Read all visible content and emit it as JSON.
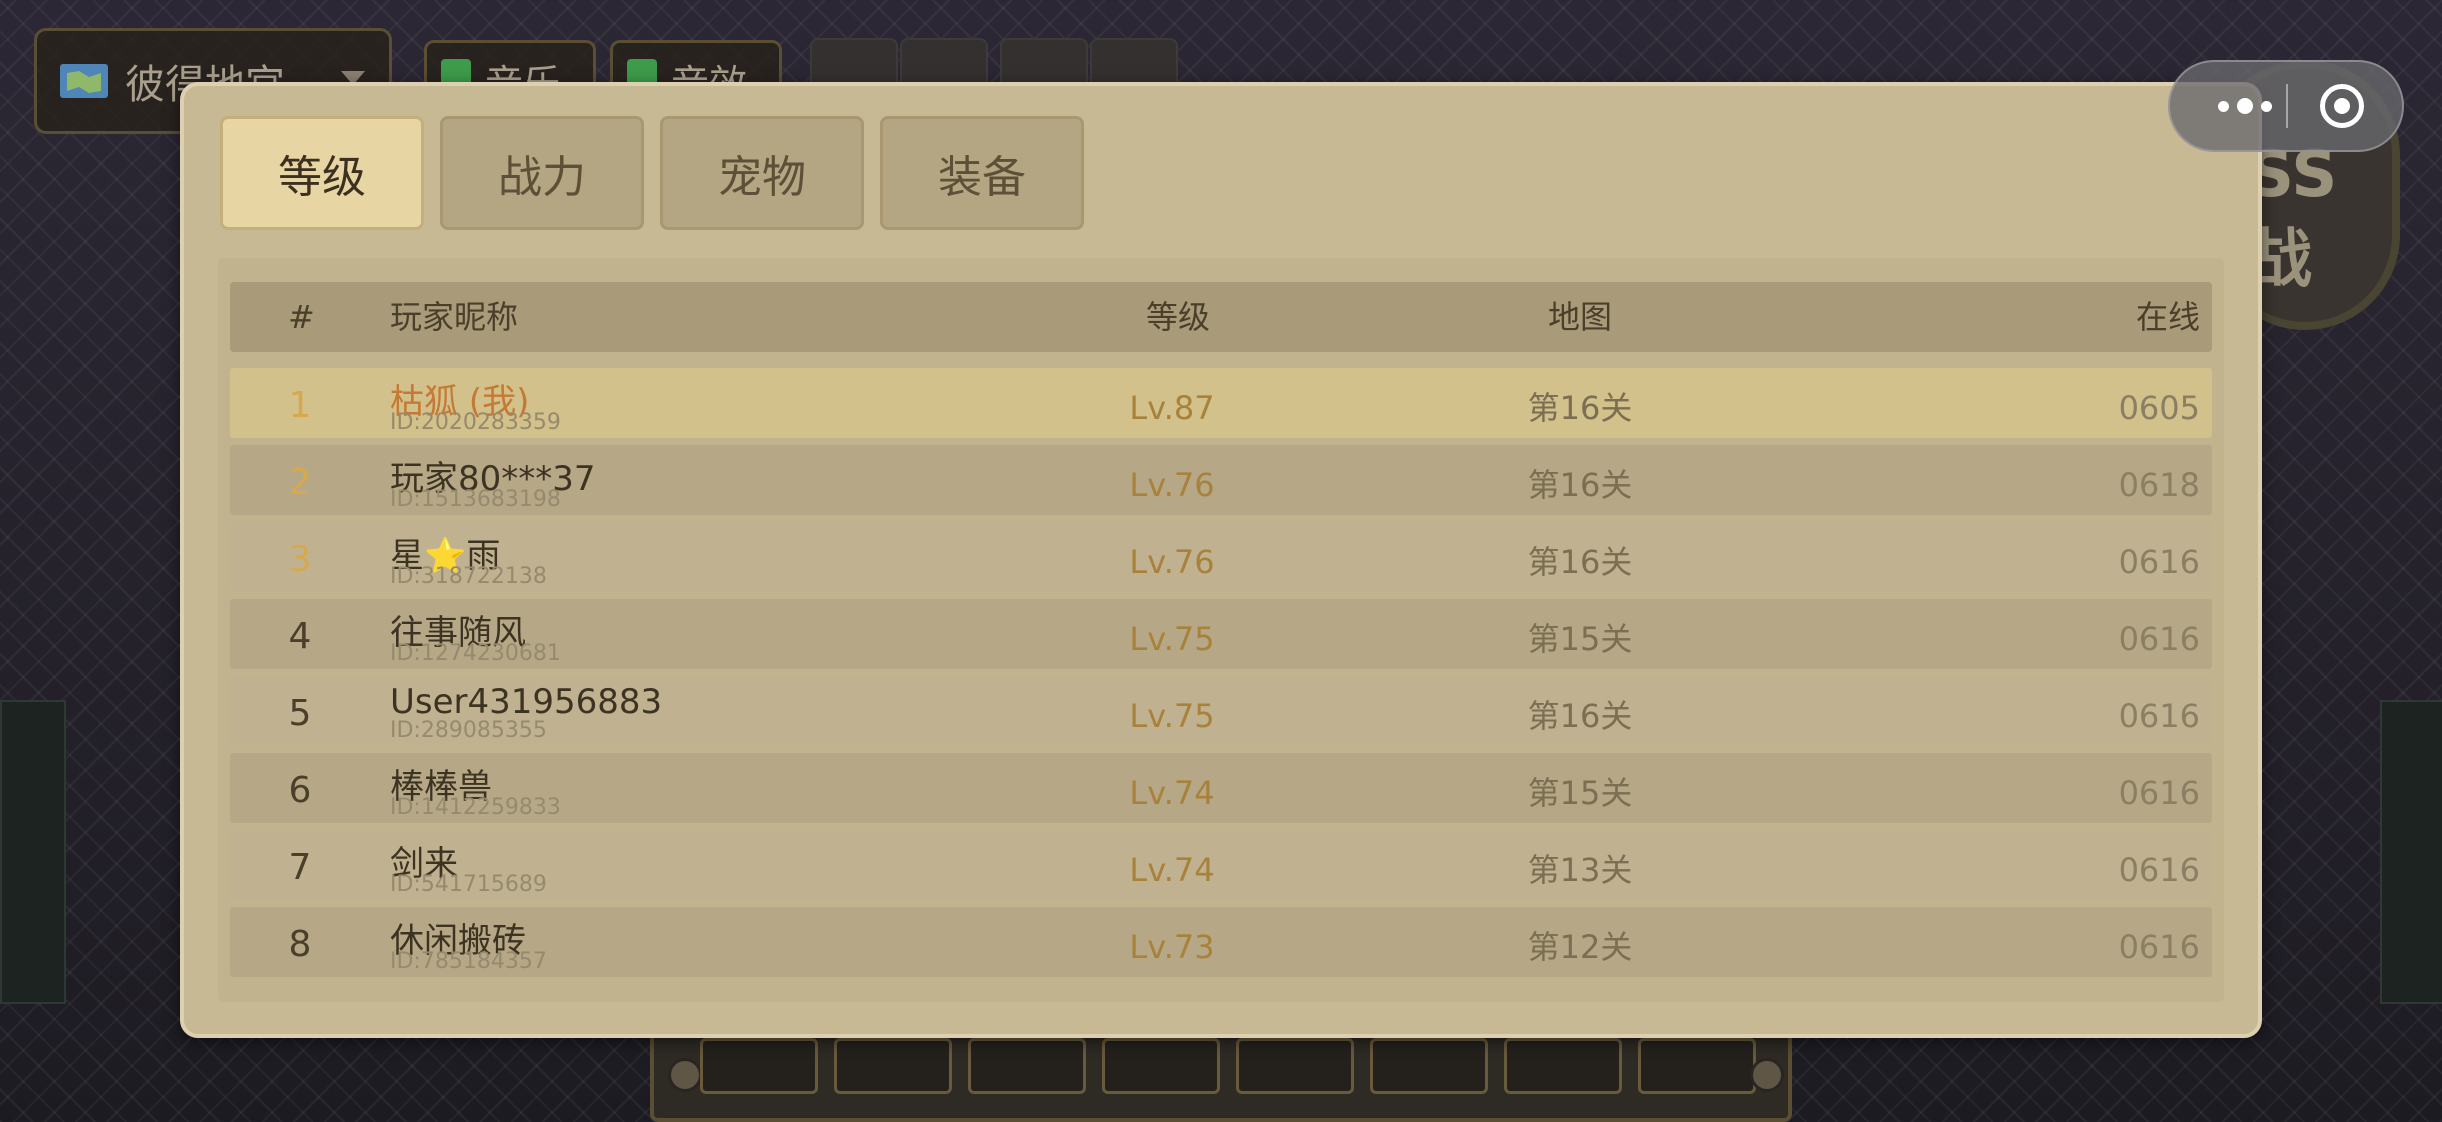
{
  "hud": {
    "map_name": "彼得地宫",
    "music_label": "音乐",
    "sound_label": "音效",
    "boss_text_top": "SS",
    "boss_text_bottom": "战"
  },
  "tabs": [
    {
      "label": "等级",
      "active": true
    },
    {
      "label": "战力",
      "active": false
    },
    {
      "label": "宠物",
      "active": false
    },
    {
      "label": "装备",
      "active": false
    }
  ],
  "table": {
    "headers": {
      "rank": "#",
      "name": "玩家昵称",
      "level": "等级",
      "map": "地图",
      "online": "在线"
    },
    "rows": [
      {
        "rank": "1",
        "name": "枯狐 (我)",
        "id": "ID:2020283359",
        "level": "Lv.87",
        "map": "第16关",
        "online": "0605"
      },
      {
        "rank": "2",
        "name": "玩家80***37",
        "id": "ID:1513683198",
        "level": "Lv.76",
        "map": "第16关",
        "online": "0618"
      },
      {
        "rank": "3",
        "name": "星⭐雨",
        "id": "ID:318722138",
        "level": "Lv.76",
        "map": "第16关",
        "online": "0616"
      },
      {
        "rank": "4",
        "name": "往事随风",
        "id": "ID:1274230681",
        "level": "Lv.75",
        "map": "第15关",
        "online": "0616"
      },
      {
        "rank": "5",
        "name": "User431956883",
        "id": "ID:289085355",
        "level": "Lv.75",
        "map": "第16关",
        "online": "0616"
      },
      {
        "rank": "6",
        "name": "棒棒兽",
        "id": "ID:1412259833",
        "level": "Lv.74",
        "map": "第15关",
        "online": "0616"
      },
      {
        "rank": "7",
        "name": "剑来",
        "id": "ID:541715689",
        "level": "Lv.74",
        "map": "第13关",
        "online": "0616"
      },
      {
        "rank": "8",
        "name": "休闲搬砖",
        "id": "ID:785184357",
        "level": "Lv.73",
        "map": "第12关",
        "online": "0616"
      }
    ]
  },
  "colors": {
    "accent_gold": "#d8a84c",
    "me_name": "#c47a34",
    "level_text": "#a8823a"
  }
}
